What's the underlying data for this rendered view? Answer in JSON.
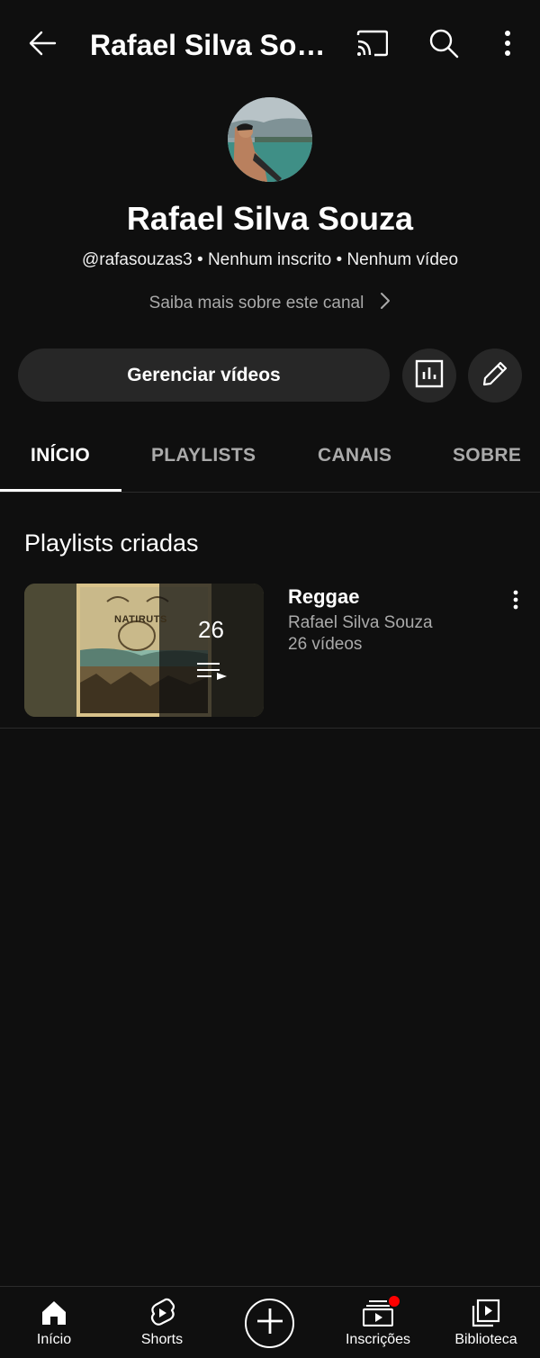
{
  "header": {
    "title": "Rafael Silva Sou…",
    "back_icon": "back-arrow-icon",
    "cast_icon": "cast-icon",
    "search_icon": "search-icon",
    "more_icon": "more-vert-icon"
  },
  "channel": {
    "name": "Rafael Silva Souza",
    "meta": "@rafasouzas3 • Nenhum inscrito • Nenhum vídeo",
    "about": "Saiba mais sobre este canal"
  },
  "actions": {
    "manage_label": "Gerenciar vídeos",
    "analytics_icon": "analytics-icon",
    "edit_icon": "pencil-icon"
  },
  "tabs": [
    {
      "label": "INÍCIO",
      "active": true
    },
    {
      "label": "PLAYLISTS",
      "active": false
    },
    {
      "label": "CANAIS",
      "active": false
    },
    {
      "label": "SOBRE",
      "active": false
    }
  ],
  "section": {
    "title": "Playlists criadas"
  },
  "playlists": [
    {
      "title": "Reggae",
      "owner": "Rafael Silva Souza",
      "count_label": "26 vídeos",
      "thumb_count": "26",
      "thumb_text": "NATIRUTS"
    }
  ],
  "bottom_nav": [
    {
      "label": "Início",
      "icon": "home-icon"
    },
    {
      "label": "Shorts",
      "icon": "shorts-icon"
    },
    {
      "label": "",
      "icon": "create-plus-icon"
    },
    {
      "label": "Inscrições",
      "icon": "subscriptions-icon"
    },
    {
      "label": "Biblioteca",
      "icon": "library-icon"
    }
  ],
  "colors": {
    "background": "#0f0f0f",
    "surface": "#272727",
    "secondary_text": "#aaaaaa",
    "notification": "#ff0000"
  }
}
